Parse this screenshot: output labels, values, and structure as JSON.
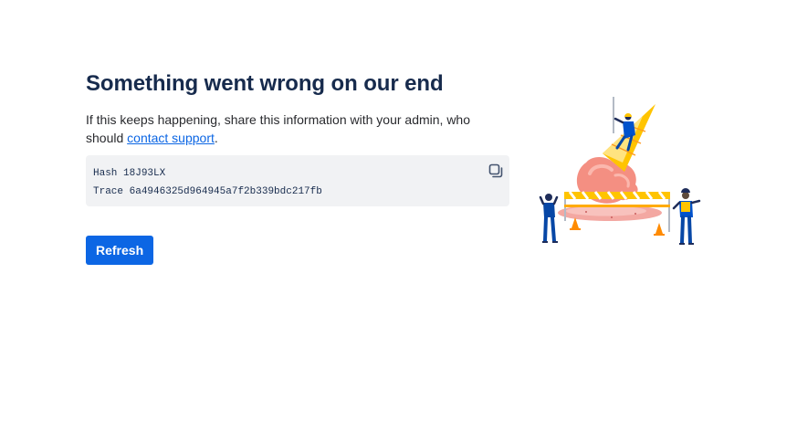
{
  "error": {
    "title": "Something went wrong on our end",
    "description_prefix": "If this keeps happening, share this information with your admin, who should ",
    "support_link": "contact support",
    "description_suffix": "."
  },
  "details": {
    "hash_label": "Hash",
    "hash_value": "18J93LX",
    "trace_label": "Trace",
    "trace_value": "6a4946325d964945a7f2b339bdc217fb"
  },
  "actions": {
    "refresh_label": "Refresh"
  },
  "icons": {
    "copy": "copy-icon",
    "illustration": "dropped-ice-cream-illustration"
  },
  "colors": {
    "primary": "#0C66E4",
    "heading": "#172B4D",
    "info_background": "#F1F2F4"
  }
}
